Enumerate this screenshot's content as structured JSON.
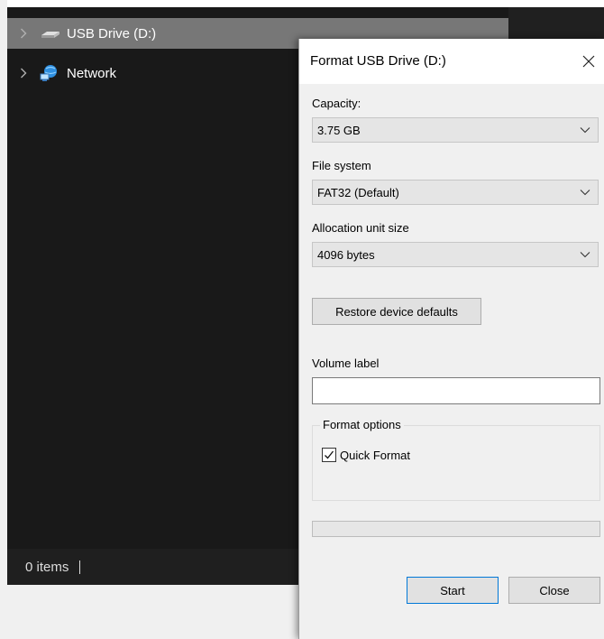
{
  "explorer": {
    "nav_items": [
      {
        "label": "USB Drive (D:)",
        "icon": "usb-drive-icon",
        "selected": true
      },
      {
        "label": "Network",
        "icon": "network-icon",
        "selected": false
      }
    ],
    "status": {
      "item_count": "0 items"
    }
  },
  "dialog": {
    "title": "Format USB Drive (D:)",
    "capacity": {
      "label": "Capacity:",
      "value": "3.75 GB"
    },
    "file_system": {
      "label": "File system",
      "value": "FAT32 (Default)"
    },
    "allocation": {
      "label": "Allocation unit size",
      "value": "4096 bytes"
    },
    "restore_label": "Restore device defaults",
    "volume": {
      "label": "Volume label",
      "value": ""
    },
    "format_options": {
      "legend": "Format options",
      "quick_format_label": "Quick Format",
      "quick_format_checked": true
    },
    "progress": 0,
    "start_label": "Start",
    "close_label": "Close"
  },
  "colors": {
    "explorer_bg": "#191919",
    "selected_row": "#777777",
    "dialog_bg": "#f0f0f0",
    "default_button_border": "#0078d7",
    "progress_fill": "#06b025"
  }
}
